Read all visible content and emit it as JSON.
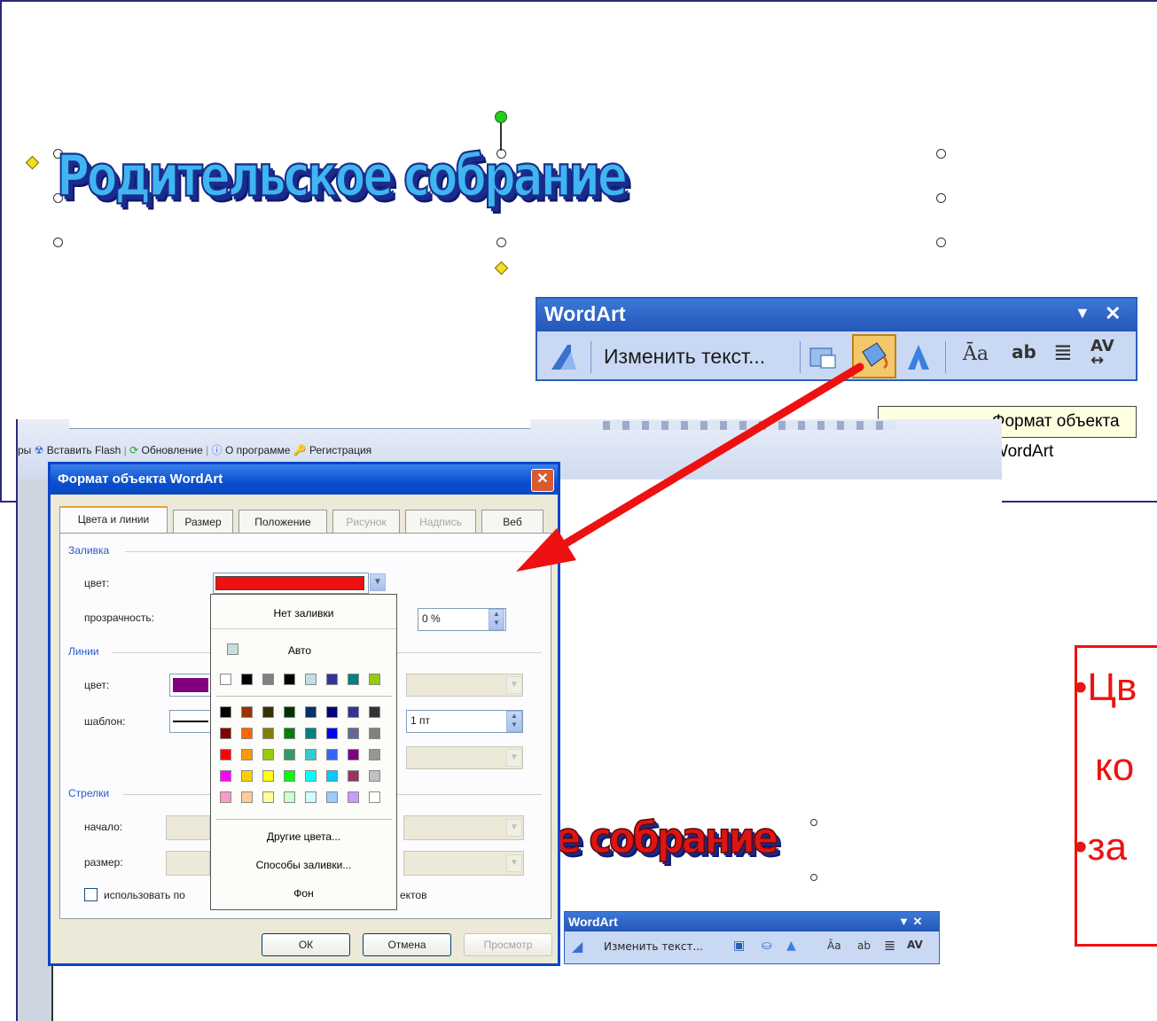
{
  "top": {
    "wordart_text": "Родительское собрание",
    "toolbar": {
      "title": "WordArt",
      "edit_text": "Изменить текст...",
      "menu_glyph": "▼",
      "close_glyph": "✕"
    },
    "tooltip": "Формат объекта WordArt"
  },
  "screenshot": {
    "toolbar_items": [
      "ры",
      "Вставить Flash",
      "Обновление",
      "О программе",
      "Регистрация"
    ],
    "wordart_text": "е собрание",
    "wordart_color": "#cc1111",
    "mini_toolbar": {
      "title": "WordArt",
      "edit_text": "Изменить текст...",
      "controls": "▼ ✕"
    }
  },
  "dialog": {
    "title": "Формат объекта WordArt",
    "close_glyph": "✕",
    "tabs": [
      {
        "label": "Цвета и линии",
        "state": "active"
      },
      {
        "label": "Размер",
        "state": "normal"
      },
      {
        "label": "Положение",
        "state": "normal"
      },
      {
        "label": "Рисунок",
        "state": "disabled"
      },
      {
        "label": "Надпись",
        "state": "disabled"
      },
      {
        "label": "Веб",
        "state": "normal"
      }
    ],
    "fill": {
      "group": "Заливка",
      "color_label": "цвет:",
      "color_value": "#ee1111",
      "transparency_label": "прозрачность:",
      "transparency_value": "0 %"
    },
    "lines": {
      "group": "Линии",
      "color_label": "цвет:",
      "color_value": "#800080",
      "pattern_label": "шаблон:",
      "weight_value": "1 пт"
    },
    "arrows": {
      "group": "Стрелки",
      "start_label": "начало:",
      "size_label": "размер:"
    },
    "checkbox_label": "использовать по",
    "checkbox_tail": "ектов",
    "buttons": {
      "ok": "ОК",
      "cancel": "Отмена",
      "preview": "Просмотр"
    }
  },
  "color_popup": {
    "no_fill": "Нет заливки",
    "auto": "Авто",
    "auto_color": "#c2dede",
    "recent_colors": [
      "#ffffff",
      "#000000",
      "#808080",
      "#000000",
      "#c0e0e0",
      "#333399",
      "#008080",
      "#99cc00"
    ],
    "palette": [
      [
        "#000000",
        "#993300",
        "#333300",
        "#003300",
        "#003366",
        "#000080",
        "#333399",
        "#333333"
      ],
      [
        "#800000",
        "#ff6600",
        "#808000",
        "#008000",
        "#008080",
        "#0000ff",
        "#666699",
        "#808080"
      ],
      [
        "#ff0000",
        "#ff9900",
        "#99cc00",
        "#339966",
        "#33cccc",
        "#3366ff",
        "#800080",
        "#969696"
      ],
      [
        "#ff00ff",
        "#ffcc00",
        "#ffff00",
        "#00ff00",
        "#00ffff",
        "#00ccff",
        "#993366",
        "#c0c0c0"
      ],
      [
        "#ff99cc",
        "#ffcc99",
        "#ffff99",
        "#ccffcc",
        "#ccffff",
        "#99ccff",
        "#cc99ff",
        "#ffffff"
      ]
    ],
    "more_colors": "Другие цвета...",
    "fill_effects": "Способы заливки...",
    "background": "Фон"
  },
  "callout": {
    "line1": "•Цв",
    "line2": "ко",
    "line3": "•за"
  },
  "colors": {
    "arrow": "#ee1111",
    "xp_blue": "#0a46c8"
  }
}
